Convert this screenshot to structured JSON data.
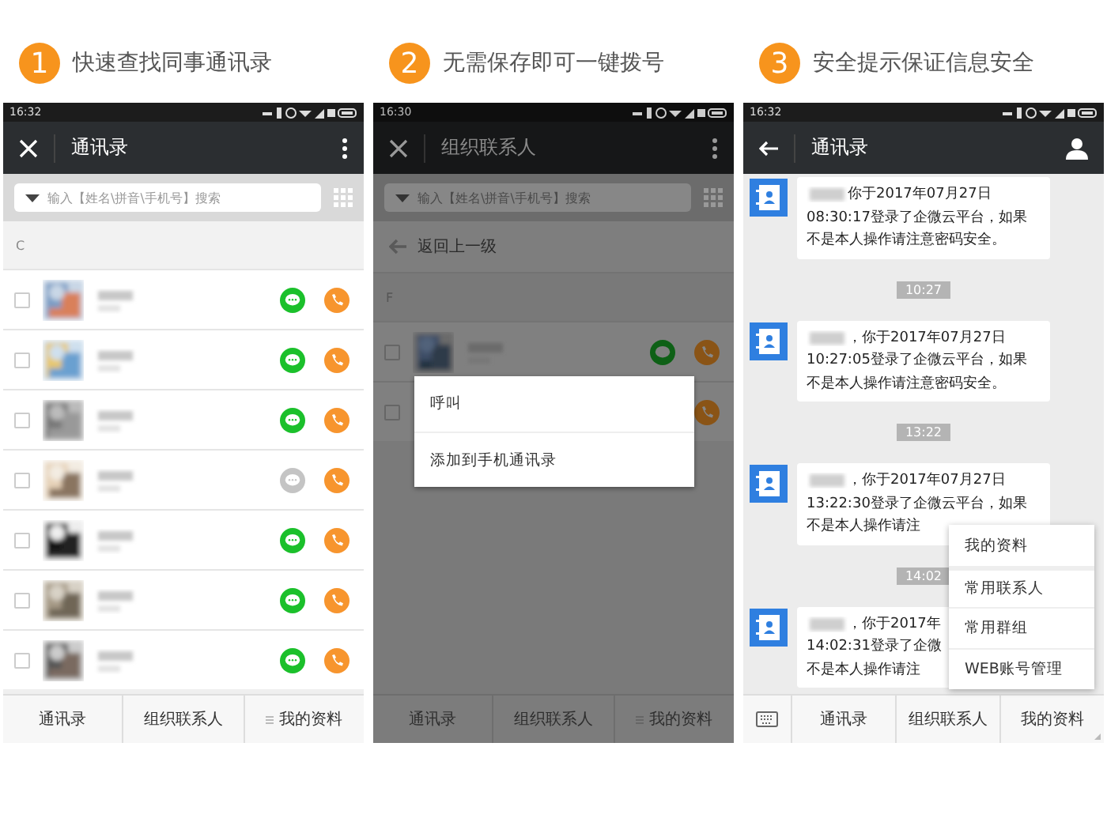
{
  "panel_1": {
    "step": "1",
    "caption": "快速查找同事通讯录",
    "time": "16:32",
    "title": "通讯录",
    "search_placeholder": "输入【姓名\\拼音\\手机号】搜索",
    "section": "C",
    "contacts": [
      {
        "checked": false,
        "chat_enabled": true
      },
      {
        "checked": false,
        "chat_enabled": true
      },
      {
        "checked": false,
        "chat_enabled": true
      },
      {
        "checked": false,
        "chat_enabled": false
      },
      {
        "checked": false,
        "chat_enabled": true
      },
      {
        "checked": false,
        "chat_enabled": true
      },
      {
        "checked": false,
        "chat_enabled": true
      }
    ],
    "tabs": [
      "通讯录",
      "组织联系人",
      "我的资料"
    ]
  },
  "panel_2": {
    "step": "2",
    "caption": "无需保存即可一键拨号",
    "time": "16:30",
    "title": "组织联系人",
    "search_placeholder": "输入【姓名\\拼音\\手机号】搜索",
    "back": "返回上一级",
    "section": "F",
    "contacts": [
      {
        "checked": false,
        "chat_enabled": true
      },
      {
        "checked": false
      }
    ],
    "popup": [
      "呼叫",
      "添加到手机通讯录"
    ],
    "tabs": [
      "通讯录",
      "组织联系人",
      "我的资料"
    ]
  },
  "panel_3": {
    "step": "3",
    "caption": "安全提示保证信息安全",
    "time": "16:32",
    "title": "通讯录",
    "feed": [
      {
        "kind": "message",
        "lines": [
          "你于2017年07月27日",
          "08:30:17登录了企微云平台，如果",
          "不是本人操作请注意密码安全。"
        ]
      },
      {
        "kind": "time",
        "text": "10:27"
      },
      {
        "kind": "message",
        "lines": [
          "，你于2017年07月27日",
          "10:27:05登录了企微云平台，如果",
          "不是本人操作请注意密码安全。"
        ]
      },
      {
        "kind": "time",
        "text": "13:22"
      },
      {
        "kind": "message",
        "lines": [
          "，你于2017年07月27日",
          "13:22:30登录了企微云平台，如果",
          "不是本人操作请注"
        ]
      },
      {
        "kind": "time",
        "text": "14:02"
      },
      {
        "kind": "message",
        "lines": [
          "，你于2017年",
          "14:02:31登录了企微",
          "不是本人操作请注"
        ]
      }
    ],
    "menu": [
      "我的资料",
      "常用联系人",
      "常用群组",
      "WEB账号管理"
    ],
    "tabs": [
      "通讯录",
      "组织联系人",
      "我的资料"
    ]
  }
}
